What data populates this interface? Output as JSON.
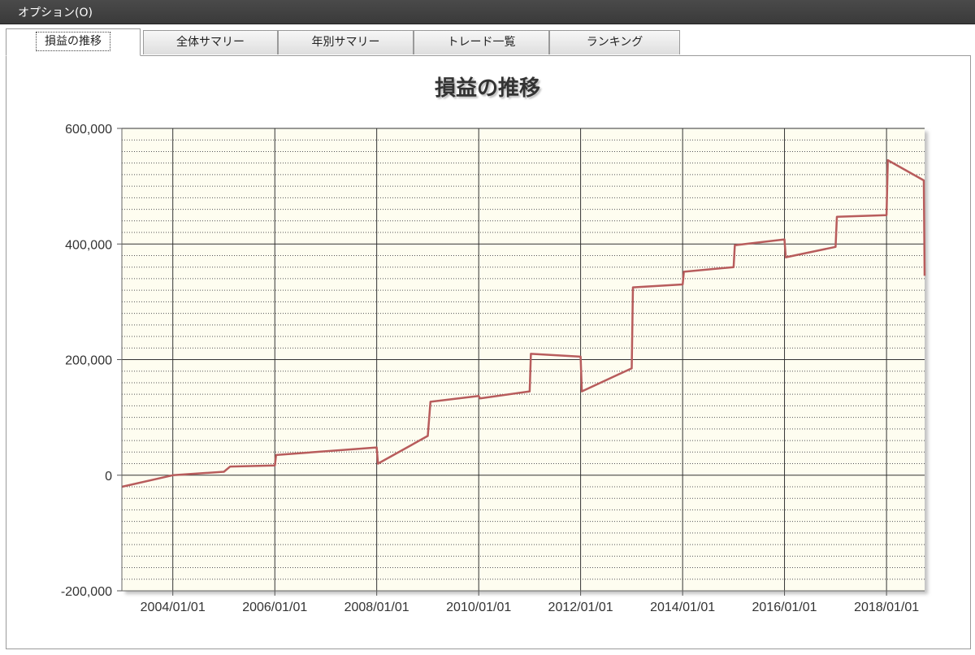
{
  "window": {
    "menu_label": "オプション(O)"
  },
  "tabs": [
    {
      "label": "損益の推移",
      "active": true
    },
    {
      "label": "全体サマリー",
      "active": false
    },
    {
      "label": "年別サマリー",
      "active": false
    },
    {
      "label": "トレード一覧",
      "active": false
    },
    {
      "label": "ランキング",
      "active": false
    }
  ],
  "colors": {
    "plot_background": "#fefdf0",
    "line": "#b85c5c",
    "grid": "#333333"
  },
  "chart_data": {
    "type": "line",
    "title": "損益の推移",
    "xlabel": "",
    "ylabel": "",
    "ylim": [
      -200000,
      600000
    ],
    "xlim": [
      "2003-01-01",
      "2018-10-01"
    ],
    "y_ticks": [
      {
        "value": 600000,
        "label": "600,000"
      },
      {
        "value": 400000,
        "label": "400,000"
      },
      {
        "value": 200000,
        "label": "200,000"
      },
      {
        "value": 0,
        "label": "0"
      },
      {
        "value": -200000,
        "label": "-200,000"
      }
    ],
    "x_ticks": [
      {
        "value": "2004-01-01",
        "label": "2004/01/01"
      },
      {
        "value": "2006-01-01",
        "label": "2006/01/01"
      },
      {
        "value": "2008-01-01",
        "label": "2008/01/01"
      },
      {
        "value": "2010-01-01",
        "label": "2010/01/01"
      },
      {
        "value": "2012-01-01",
        "label": "2012/01/01"
      },
      {
        "value": "2014-01-01",
        "label": "2014/01/01"
      },
      {
        "value": "2016-01-01",
        "label": "2016/01/01"
      },
      {
        "value": "2018-01-01",
        "label": "2018/01/01"
      }
    ],
    "grid": true,
    "series": [
      {
        "points": [
          [
            "2003-01-01",
            -20000
          ],
          [
            "2004-01-01",
            0
          ],
          [
            "2005-01-01",
            6000
          ],
          [
            "2005-02-15",
            15000
          ],
          [
            "2006-01-01",
            17000
          ],
          [
            "2006-01-10",
            35000
          ],
          [
            "2008-01-01",
            48000
          ],
          [
            "2008-01-10",
            20000
          ],
          [
            "2009-01-01",
            68000
          ],
          [
            "2009-01-20",
            127000
          ],
          [
            "2010-01-01",
            137000
          ],
          [
            "2010-01-10",
            133000
          ],
          [
            "2011-01-01",
            145000
          ],
          [
            "2011-01-10",
            210000
          ],
          [
            "2012-01-01",
            205000
          ],
          [
            "2012-01-10",
            145000
          ],
          [
            "2013-01-01",
            185000
          ],
          [
            "2013-01-10",
            325000
          ],
          [
            "2014-01-01",
            330000
          ],
          [
            "2014-01-10",
            352000
          ],
          [
            "2015-01-01",
            360000
          ],
          [
            "2015-01-10",
            398000
          ],
          [
            "2016-01-01",
            408000
          ],
          [
            "2016-01-10",
            377000
          ],
          [
            "2017-01-01",
            395000
          ],
          [
            "2017-01-10",
            447000
          ],
          [
            "2018-01-01",
            450000
          ],
          [
            "2018-01-10",
            545000
          ],
          [
            "2018-09-25",
            510000
          ],
          [
            "2018-10-01",
            345000
          ]
        ]
      }
    ]
  }
}
